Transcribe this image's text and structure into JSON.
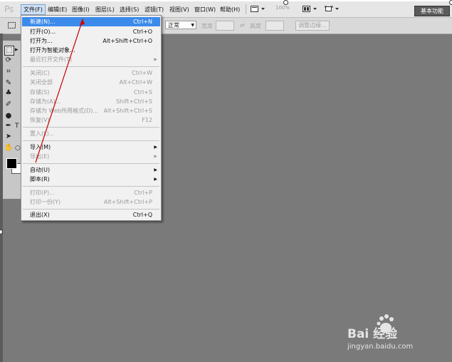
{
  "app": {
    "logo": "Ps",
    "workspace_button": "基本功能",
    "zoom_level": "100%"
  },
  "menubar": {
    "items": [
      "文件(F)",
      "编辑(E)",
      "图像(I)",
      "图层(L)",
      "选择(S)",
      "滤镜(T)",
      "视图(V)",
      "窗口(W)",
      "帮助(H)"
    ],
    "active_index": 0
  },
  "options_bar": {
    "mode_value": "正常",
    "width_label": "宽度",
    "height_label": "高度",
    "refine_edge_button": "调整边缘..."
  },
  "file_menu": {
    "highlighted_index": 0,
    "items": [
      {
        "label": "新建(N)...",
        "shortcut": "Ctrl+N",
        "enabled": true,
        "submenu": false
      },
      {
        "label": "打开(O)...",
        "shortcut": "Ctrl+O",
        "enabled": true,
        "submenu": false
      },
      {
        "label": "打开为...",
        "shortcut": "Alt+Shift+Ctrl+O",
        "enabled": true,
        "submenu": false
      },
      {
        "label": "打开为智能对象...",
        "shortcut": "",
        "enabled": true,
        "submenu": false
      },
      {
        "label": "最近打开文件(T)",
        "shortcut": "",
        "enabled": false,
        "submenu": true
      },
      {
        "label": "关闭(C)",
        "shortcut": "Ctrl+W",
        "enabled": false,
        "submenu": false
      },
      {
        "label": "关闭全部",
        "shortcut": "Alt+Ctrl+W",
        "enabled": false,
        "submenu": false
      },
      {
        "label": "存储(S)",
        "shortcut": "Ctrl+S",
        "enabled": false,
        "submenu": false
      },
      {
        "label": "存储为(A)...",
        "shortcut": "Shift+Ctrl+S",
        "enabled": false,
        "submenu": false
      },
      {
        "label": "存储为 Web所用格式(D)...",
        "shortcut": "Alt+Shift+Ctrl+S",
        "enabled": false,
        "submenu": false
      },
      {
        "label": "恢复(V)",
        "shortcut": "F12",
        "enabled": false,
        "submenu": false
      },
      {
        "label": "置入(L)...",
        "shortcut": "",
        "enabled": false,
        "submenu": false
      },
      {
        "label": "导入(M)",
        "shortcut": "",
        "enabled": true,
        "submenu": true
      },
      {
        "label": "导出(E)",
        "shortcut": "",
        "enabled": false,
        "submenu": true
      },
      {
        "label": "自动(U)",
        "shortcut": "",
        "enabled": true,
        "submenu": true
      },
      {
        "label": "脚本(R)",
        "shortcut": "",
        "enabled": true,
        "submenu": true
      },
      {
        "label": "打印(P)...",
        "shortcut": "Ctrl+P",
        "enabled": false,
        "submenu": false
      },
      {
        "label": "打印一份(Y)",
        "shortcut": "Alt+Shift+Ctrl+P",
        "enabled": false,
        "submenu": false
      },
      {
        "label": "退出(X)",
        "shortcut": "Ctrl+Q",
        "enabled": true,
        "submenu": false
      }
    ]
  },
  "watermark": {
    "logo_text": "Bai  经验",
    "url": "jingyan.baidu.com"
  },
  "colors": {
    "annotation_arrow": "#cc0000",
    "highlight": "#3c8bea",
    "canvas": "#7a7a7a"
  }
}
